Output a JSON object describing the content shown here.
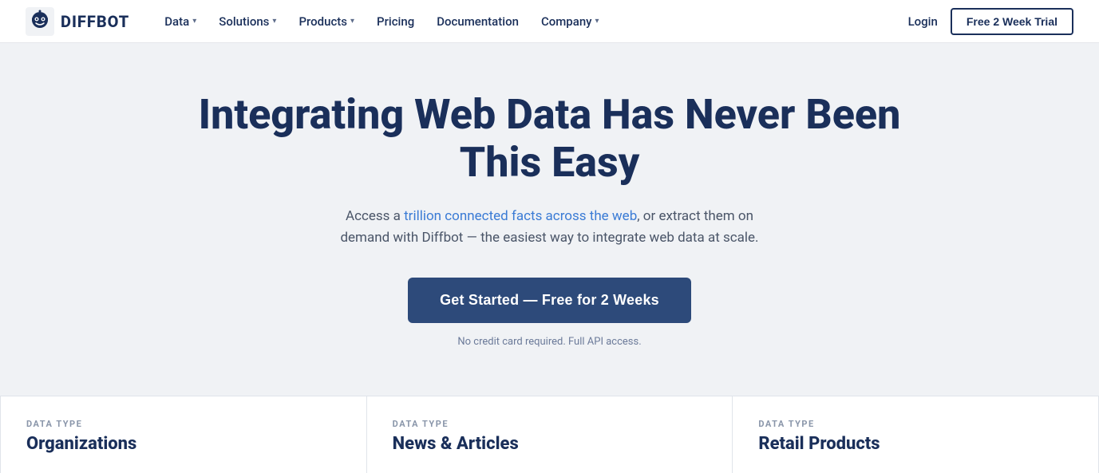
{
  "nav": {
    "logo_text": "DIFFBOT",
    "items": [
      {
        "label": "Data",
        "has_dropdown": true
      },
      {
        "label": "Solutions",
        "has_dropdown": true
      },
      {
        "label": "Products",
        "has_dropdown": true
      },
      {
        "label": "Pricing",
        "has_dropdown": false
      },
      {
        "label": "Documentation",
        "has_dropdown": false
      },
      {
        "label": "Company",
        "has_dropdown": true
      }
    ],
    "login_label": "Login",
    "trial_btn_label": "Free 2 Week Trial"
  },
  "hero": {
    "title": "Integrating Web Data Has Never Been This Easy",
    "subtitle_plain": "Access a ",
    "subtitle_link": "trillion connected facts across the web",
    "subtitle_end": ", or extract them on demand with Diffbot — the easiest way to integrate web data at scale.",
    "cta_label": "Get Started — Free for 2 Weeks",
    "cta_subtext": "No credit card required. Full API access."
  },
  "data_cards": [
    {
      "type_label": "DATA TYPE",
      "type_name": "Organizations"
    },
    {
      "type_label": "DATA TYPE",
      "type_name": "News & Articles"
    },
    {
      "type_label": "DATA TYPE",
      "type_name": "Retail Products"
    }
  ]
}
